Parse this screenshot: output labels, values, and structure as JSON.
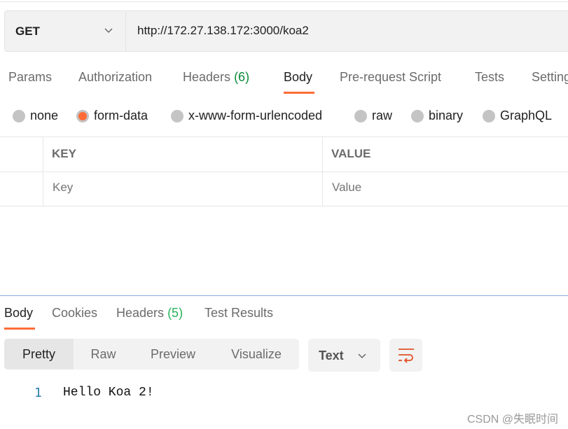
{
  "request": {
    "method": "GET",
    "url": "http://172.27.138.172:3000/koa2"
  },
  "request_tabs": [
    {
      "label": "Params"
    },
    {
      "label": "Authorization"
    },
    {
      "label": "Headers",
      "count": "(6)"
    },
    {
      "label": "Body",
      "active": true
    },
    {
      "label": "Pre-request Script"
    },
    {
      "label": "Tests"
    },
    {
      "label": "Settings"
    }
  ],
  "body_types": [
    {
      "label": "none"
    },
    {
      "label": "form-data",
      "selected": true
    },
    {
      "label": "x-www-form-urlencoded"
    },
    {
      "label": "raw"
    },
    {
      "label": "binary"
    },
    {
      "label": "GraphQL"
    }
  ],
  "table": {
    "headers": [
      "KEY",
      "VALUE"
    ],
    "placeholders": {
      "key": "Key",
      "value": "Value"
    }
  },
  "response_tabs": [
    {
      "label": "Body",
      "active": true
    },
    {
      "label": "Cookies"
    },
    {
      "label": "Headers",
      "count": "(5)"
    },
    {
      "label": "Test Results"
    }
  ],
  "view_modes": [
    {
      "label": "Pretty",
      "selected": true
    },
    {
      "label": "Raw"
    },
    {
      "label": "Preview"
    },
    {
      "label": "Visualize"
    }
  ],
  "format": "Text",
  "response_lines": [
    {
      "number": "1",
      "text": "Hello Koa 2!"
    }
  ],
  "watermark": "CSDN @失眠时间",
  "colors": {
    "accent": "#ff6c37",
    "count_green": "#0a8a3a"
  }
}
